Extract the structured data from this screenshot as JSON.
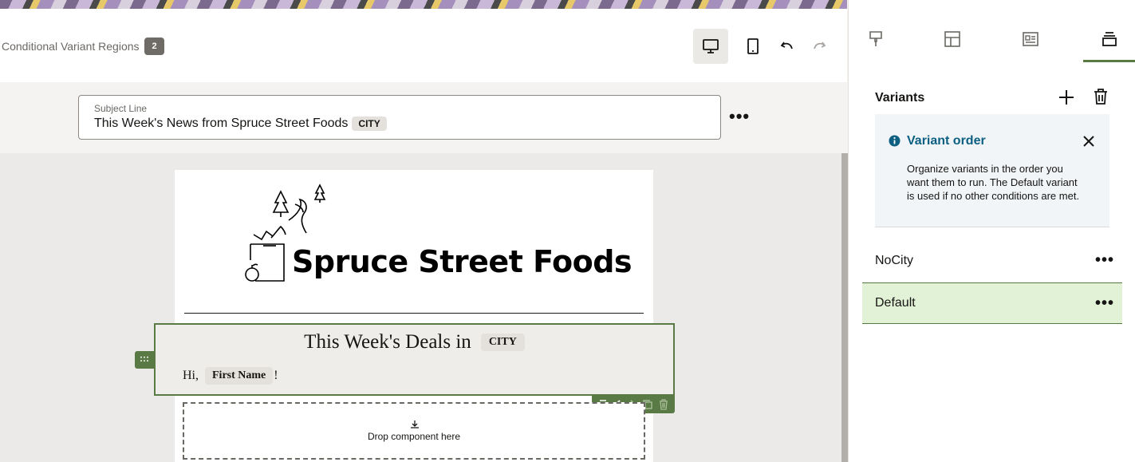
{
  "header": {
    "breadcrumb": "Conditional Variant Regions",
    "badge_count": "2"
  },
  "subject": {
    "label": "Subject Line",
    "value": "This Week's News from Spruce Street Foods",
    "token": "CITY"
  },
  "email": {
    "brand": "Spruce Street Foods",
    "heading_text": "This Week's Deals in",
    "heading_token": "CITY",
    "greeting_prefix": "Hi,",
    "greeting_token": "First Name",
    "greeting_suffix": "!",
    "drop_text": "Drop component here"
  },
  "panel": {
    "title": "Variants",
    "info_title": "Variant order",
    "info_text": "Organize variants in the order you want them to run. The Default variant is used if no other conditions are met.",
    "variants": [
      {
        "label": "NoCity",
        "selected": false
      },
      {
        "label": "Default",
        "selected": true
      }
    ]
  },
  "colors": {
    "accent": "#5a7a45",
    "selected_bg": "#e1f2d7",
    "info_blue": "#0c5f82"
  },
  "icons": [
    "desktop-icon",
    "mobile-icon",
    "undo-icon",
    "redo-icon",
    "more-icon",
    "paint-icon",
    "layout-icon",
    "content-icon",
    "variants-icon",
    "plus-icon",
    "trash-icon",
    "info-icon",
    "close-icon",
    "download-icon",
    "drag-handle-icon"
  ]
}
